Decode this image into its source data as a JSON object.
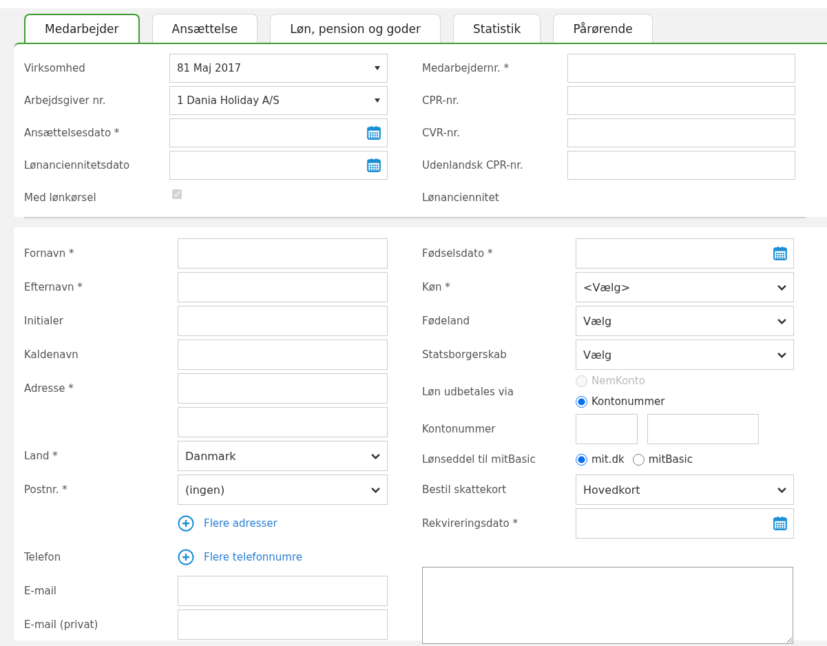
{
  "tabs": [
    {
      "label": "Medarbejder",
      "selected": true
    },
    {
      "label": "Ansættelse",
      "selected": false
    },
    {
      "label": "Løn, pension og goder",
      "selected": false
    },
    {
      "label": "Statistik",
      "selected": false
    },
    {
      "label": "Pårørende",
      "selected": false
    }
  ],
  "employment": {
    "left": [
      {
        "label": "Virksomhed",
        "kind": "dropdown",
        "value": "81 Maj 2017"
      },
      {
        "label": "Arbejdsgiver nr.",
        "kind": "dropdown",
        "value": "1 Dania Holiday A/S"
      },
      {
        "label": "Ansættelsesdato *",
        "kind": "date"
      },
      {
        "label": "Lønanciennitetsdato",
        "kind": "date"
      },
      {
        "label": "Med lønkørsel",
        "kind": "checkbox",
        "checked": true
      }
    ],
    "right": [
      {
        "label": "Medarbejdernr. *",
        "kind": "input"
      },
      {
        "label": "CPR-nr.",
        "kind": "input"
      },
      {
        "label": "CVR-nr.",
        "kind": "input"
      },
      {
        "label": "Udenlandsk CPR-nr.",
        "kind": "input"
      },
      {
        "label": "Lønanciennitet",
        "kind": "text"
      }
    ]
  },
  "person": {
    "left": [
      {
        "label": "Fornavn *",
        "kind": "input"
      },
      {
        "label": "Efternavn *",
        "kind": "input"
      },
      {
        "label": "Initialer",
        "kind": "input"
      },
      {
        "label": "Kaldenavn",
        "kind": "input"
      },
      {
        "label": "Adresse *",
        "kind": "input"
      },
      {
        "kind": "input"
      },
      {
        "label": "Land *",
        "kind": "select",
        "value": "Danmark"
      },
      {
        "label": "Postnr. *",
        "kind": "select",
        "value": "(ingen)"
      },
      {
        "kind": "link",
        "link": "Flere adresser"
      },
      {
        "label": "Telefon",
        "kind": "link",
        "link": "Flere telefonnumre"
      },
      {
        "label": "E-mail",
        "kind": "input"
      },
      {
        "label": "E-mail (privat)",
        "kind": "input"
      }
    ],
    "right": [
      {
        "label": "Fødselsdato *",
        "kind": "date"
      },
      {
        "label": "Køn *",
        "kind": "select",
        "value": "<Vælg>"
      },
      {
        "label": "Fødeland",
        "kind": "select",
        "value": "Vælg"
      },
      {
        "label": "Statsborgerskab",
        "kind": "select",
        "value": "Vælg"
      },
      {
        "label": "Løn udbetales via",
        "kind": "radio-column",
        "options": [
          {
            "label": "NemKonto",
            "selected": false,
            "disabled": true
          },
          {
            "label": "Kontonummer",
            "selected": true,
            "disabled": false
          }
        ]
      },
      {
        "label": "Kontonummer",
        "kind": "split"
      },
      {
        "label": "Lønseddel til mitBasic",
        "kind": "radio-row",
        "options": [
          {
            "label": "mit.dk",
            "selected": true,
            "disabled": false
          },
          {
            "label": "mitBasic",
            "selected": false,
            "disabled": false
          }
        ]
      },
      {
        "label": "Bestil skattekort",
        "kind": "select",
        "value": "Hovedkort"
      },
      {
        "label": "Rekvireringsdato *",
        "kind": "date"
      },
      {
        "kind": "textarea"
      }
    ]
  }
}
